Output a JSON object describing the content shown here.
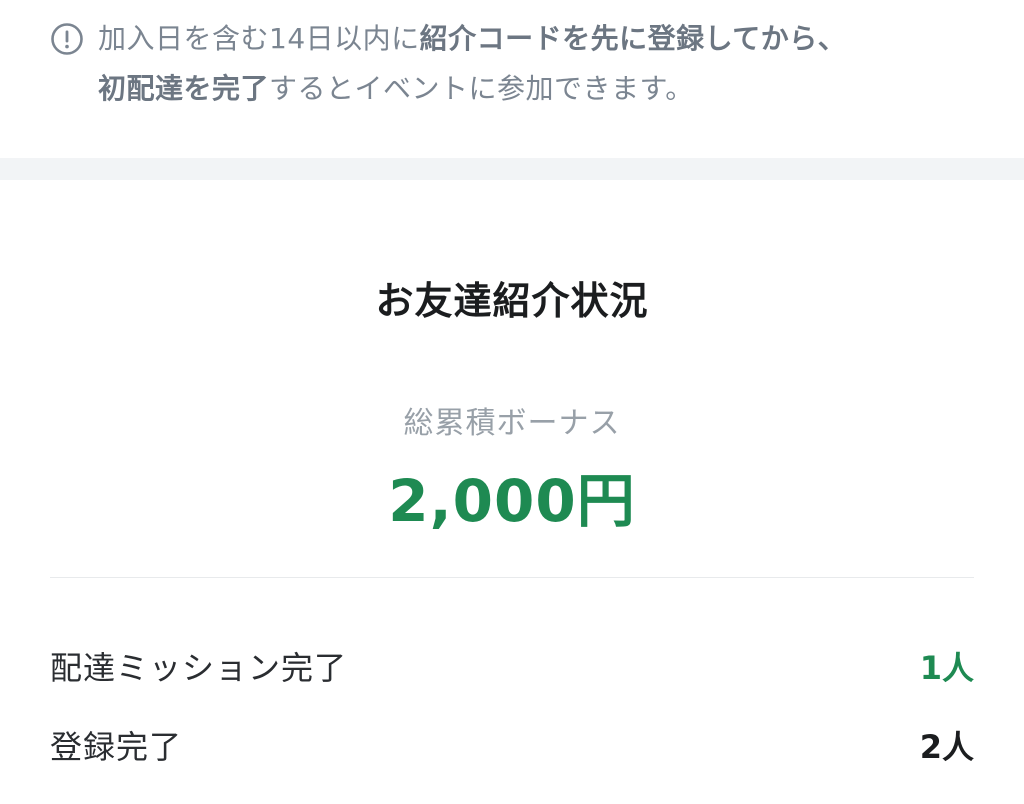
{
  "notice": {
    "icon": "exclamation-circle-icon",
    "line1_pre": "加入日を含む14日以内に",
    "line1_bold": "紹介コードを先に登録してから、",
    "line2_bold": "初配達を完了",
    "line2_post": "するとイベントに参加できます。"
  },
  "status": {
    "title": "お友達紹介状況",
    "bonus_label": "総累積ボーナス",
    "bonus_amount": "2,000円",
    "rows": [
      {
        "label": "配達ミッション完了",
        "value": "1人",
        "value_color": "#1e8a52"
      },
      {
        "label": "登録完了",
        "value": "2人",
        "value_color": "#1b1d1f"
      }
    ]
  },
  "colors": {
    "accent_green": "#1e8a52",
    "muted_text": "#7b8591",
    "band": "#f2f4f6"
  }
}
